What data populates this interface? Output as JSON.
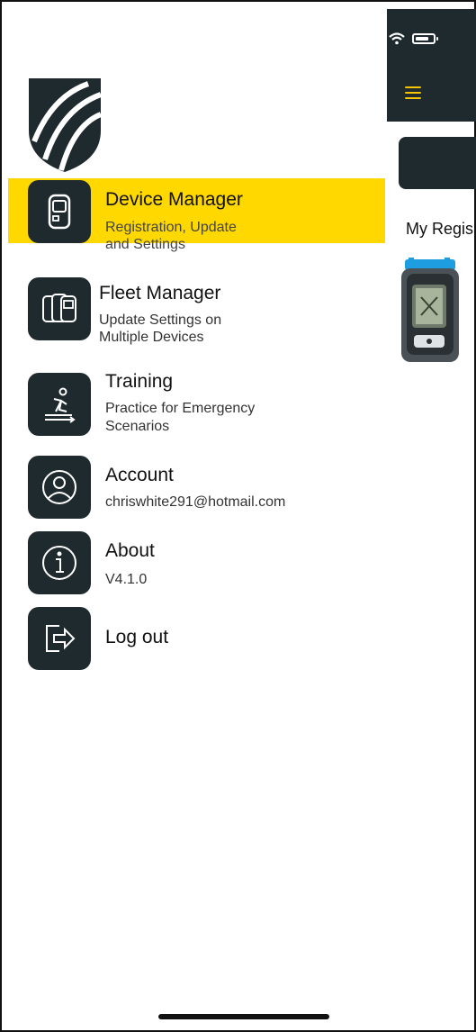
{
  "menu": {
    "items": [
      {
        "title": "Device Manager",
        "subtitle": [
          "Registration, Update",
          "and Settings"
        ],
        "active": true,
        "icon": "device-icon"
      },
      {
        "title": "Fleet Manager",
        "subtitle": [
          "Update Settings on",
          "Multiple Devices"
        ],
        "active": false,
        "icon": "fleet-icon"
      },
      {
        "title": "Training",
        "subtitle": [
          "Practice for Emergency",
          "Scenarios"
        ],
        "active": false,
        "icon": "training-icon"
      },
      {
        "title": "Account",
        "subtitle": [
          "chriswhite291@hotmail.com"
        ],
        "active": false,
        "icon": "user-icon"
      },
      {
        "title": "About",
        "subtitle": [
          "V4.1.0"
        ],
        "active": false,
        "icon": "info-icon"
      },
      {
        "title": "Log out",
        "subtitle": [],
        "active": false,
        "icon": "logout-icon"
      }
    ]
  },
  "background_app": {
    "section_label": "My Regis"
  },
  "colors": {
    "accent": "#ffd800",
    "dark": "#1f2a2e",
    "menu_icon_color": "#ffffff"
  }
}
